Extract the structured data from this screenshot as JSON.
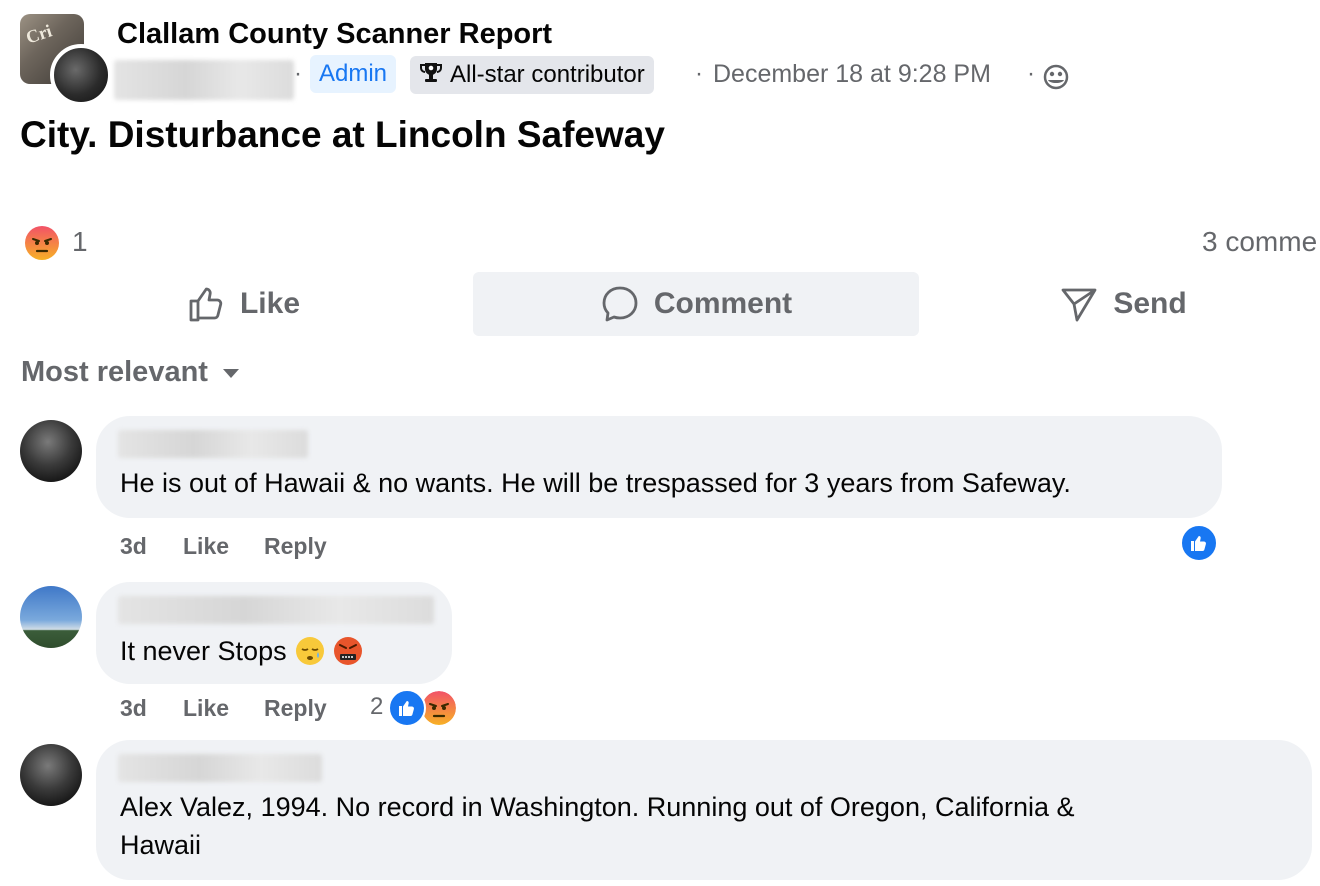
{
  "post": {
    "group_name": "Clallam County Scanner Report",
    "admin_badge": "Admin",
    "contributor_badge": "All-star contributor",
    "separator": "·",
    "timestamp": "December 18 at 9:28 PM",
    "text": "City. Disturbance at Lincoln Safeway",
    "reaction_count": "1",
    "comment_count": "3 comme"
  },
  "actions": {
    "like": "Like",
    "comment": "Comment",
    "send": "Send"
  },
  "sort_label": "Most relevant",
  "comments": [
    {
      "text": "He is out of Hawaii & no wants. He will be trespassed for 3 years from Safeway.",
      "time": "3d",
      "like": "Like",
      "reply": "Reply"
    },
    {
      "text": "It never Stops",
      "time": "3d",
      "like": "Like",
      "reply": "Reply",
      "reaction_count": "2"
    },
    {
      "text_line1": "Alex Valez, 1994. No record in Washington. Running out of Oregon, California &",
      "text_line2": "Hawaii"
    }
  ],
  "colors": {
    "accent": "#1877f2",
    "secondary_text": "#65676b",
    "bubble": "#f0f2f5",
    "angry": "#e9710f"
  },
  "icons": [
    "trophy-icon",
    "audience-icon",
    "angry-reaction-icon",
    "like-icon",
    "comment-icon",
    "send-icon",
    "caret-down-icon",
    "like-reaction-icon",
    "sleepy-emoji-icon",
    "cursing-emoji-icon"
  ]
}
